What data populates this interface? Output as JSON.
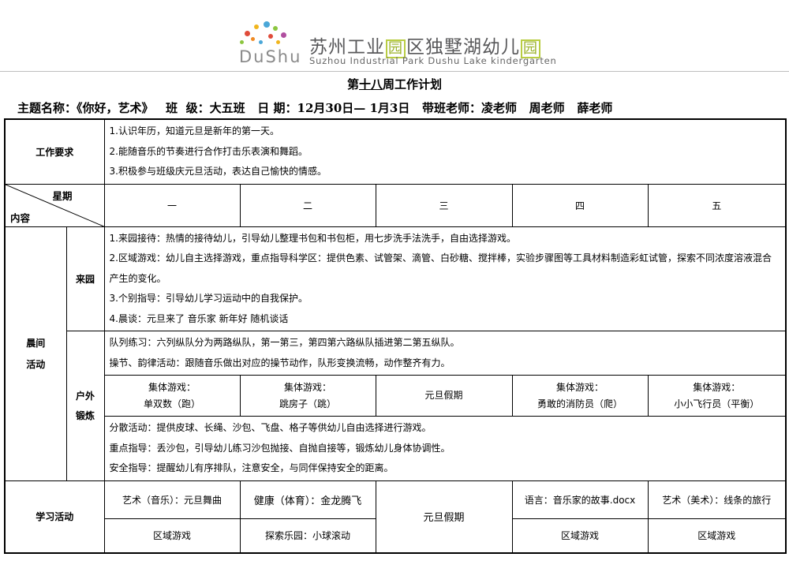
{
  "header": {
    "logo_word": "DuShu",
    "school_cn_parts": [
      "苏州工业",
      "园",
      "区独墅湖幼儿",
      "园"
    ],
    "school_en": "Suzhou Industrial Park Dushu Lake kindergarten",
    "logo_colors": [
      "#e04b3a",
      "#f1b51c",
      "#4aa7d8",
      "#8cc63f",
      "#b04fa0",
      "#f08a24"
    ]
  },
  "title": {
    "prefix": "第",
    "week": "十八",
    "suffix": "周工作计划"
  },
  "info_line": "主题名称：《你好，艺术》   班  级：大五班   日 期：12月30日— 1月3日   带班老师：凌老师   周老师   薛老师",
  "table": {
    "requirements": {
      "label": "工作要求",
      "items": [
        "1.认识年历，知道元旦是新年的第一天。",
        "2.能随音乐的节奏进行合作打击乐表演和舞蹈。",
        "3.积极参与班级庆元旦活动，表达自己愉快的情感。"
      ]
    },
    "header_row": {
      "weekday_label": "星期",
      "content_label": "内容",
      "days": [
        "一",
        "二",
        "三",
        "四",
        "五"
      ]
    },
    "morning": {
      "label_line1": "晨间",
      "label_line2": "活动",
      "arrival": {
        "label": "来园",
        "items": [
          "1.来园接待：热情的接待幼儿，引导幼儿整理书包和书包柜，用七步洗手法洗手，自由选择游戏。",
          "2.区域游戏：幼儿自主选择游戏，重点指导科学区：提供色素、试管架、滴管、白砂糖、搅拌棒，实验步骤图等工具材料制造彩虹试管，探索不同浓度溶液混合产生的变化。",
          "3.个别指导：引导幼儿学习运动中的自我保护。",
          "4.晨谈：元旦来了   音乐家    新年好   随机谈话"
        ]
      },
      "outdoor": {
        "label_line1": "户外",
        "label_line2": "锻炼",
        "top_items": [
          "队列练习：六列纵队分为两路纵队，第一第三，第四第六路纵队插进第二第五纵队。",
          "操节、韵律活动：跟随音乐做出对应的操节动作，队形变换流畅，动作整齐有力。"
        ],
        "games": [
          {
            "title": "集体游戏：",
            "name": "单双数（跑）"
          },
          {
            "title": "集体游戏：",
            "name": "跳房子（跳）"
          },
          {
            "title": "",
            "name": "元旦假期"
          },
          {
            "title": "集体游戏：",
            "name": "勇敢的消防员（爬）"
          },
          {
            "title": "集体游戏：",
            "name": "小小飞行员（平衡）"
          }
        ],
        "bottom_items": [
          "分散活动：提供皮球、长绳、沙包、飞盘、格子等供幼儿自由选择进行游戏。",
          "重点指导：丢沙包，引导幼儿练习沙包抛接、自抛自接等，锻炼幼儿身体协调性。",
          "安全指导：提醒幼儿有序排队，注意安全，与同伴保持安全的距离。"
        ]
      }
    },
    "learning": {
      "label": "学习活动",
      "row1": [
        "艺术（音乐）：元旦舞曲",
        "健康（体育）：金龙腾飞",
        "元旦假期",
        "语言：音乐家的故事.docx",
        "艺术（美术）：线条的旅行"
      ],
      "row2": [
        "区域游戏",
        "探索乐园：小球滚动",
        "区域游戏",
        "区域游戏"
      ]
    }
  }
}
